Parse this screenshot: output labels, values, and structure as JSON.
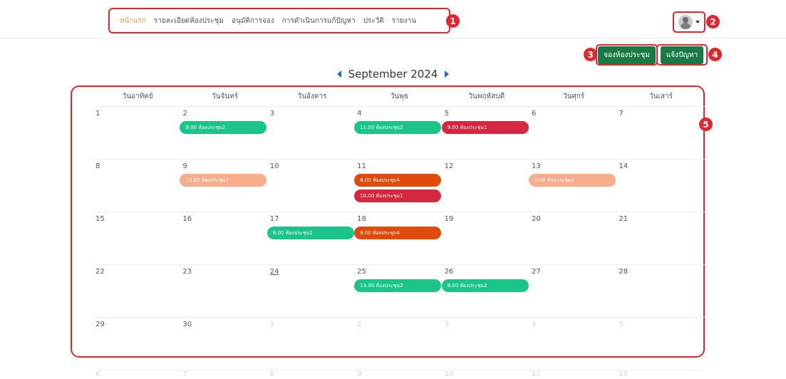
{
  "nav": {
    "items": [
      "หน้าแรก",
      "รายละเอียดห้องประชุม",
      "อนุมัติการจอง",
      "การดำเนินการแก้ปัญหา",
      "ประวัติ",
      "รายงาน"
    ]
  },
  "actions": {
    "book_label": "จองห้องประชุม",
    "report_label": "แจ้งปัญหา"
  },
  "calendar": {
    "month_label": "September 2024",
    "weekdays": [
      "วันอาทิตย์",
      "วันจันทร์",
      "วันอังคาร",
      "วันพุธ",
      "วันพฤหัสบดี",
      "วันศุกร์",
      "วันเสาร์"
    ],
    "weeks": [
      [
        "1",
        "2",
        "3",
        "4",
        "5",
        "6",
        "7"
      ],
      [
        "8",
        "9",
        "10",
        "11",
        "12",
        "13",
        "14"
      ],
      [
        "15",
        "16",
        "17",
        "18",
        "19",
        "20",
        "21"
      ],
      [
        "22",
        "23",
        "24",
        "25",
        "26",
        "27",
        "28"
      ],
      [
        "29",
        "30",
        "1",
        "2",
        "3",
        "4",
        "5"
      ]
    ],
    "next_month_days": [
      "6",
      "7",
      "8",
      "9",
      "10",
      "11",
      "12"
    ],
    "events": [
      {
        "week": 0,
        "day": 1,
        "slot": 0,
        "label": "9.00 ห้องประชุม2",
        "color": "#1cc48a"
      },
      {
        "week": 0,
        "day": 3,
        "slot": 0,
        "label": "11.00 ห้องประชุม2",
        "color": "#1cc48a"
      },
      {
        "week": 0,
        "day": 4,
        "slot": 0,
        "label": "9.00 ห้องประชุม1",
        "color": "#d3283f"
      },
      {
        "week": 1,
        "day": 1,
        "slot": 0,
        "label": "13.00 ห้องประชุม3",
        "color": "#f7ad8c"
      },
      {
        "week": 1,
        "day": 3,
        "slot": 0,
        "label": "8.00 ห้องประชุม4",
        "color": "#e04b0c"
      },
      {
        "week": 1,
        "day": 3,
        "slot": 1,
        "label": "10.00 ห้องประชุม1",
        "color": "#d3283f"
      },
      {
        "week": 1,
        "day": 5,
        "slot": 0,
        "label": "9.00 ห้องประชุม3",
        "color": "#f7ad8c"
      },
      {
        "week": 2,
        "day": 2,
        "slot": 0,
        "label": "8.00 ห้องประชุม2",
        "color": "#1cc48a"
      },
      {
        "week": 2,
        "day": 3,
        "slot": 0,
        "label": "9.00 ห้องประชุม4",
        "color": "#e04b0c"
      },
      {
        "week": 3,
        "day": 3,
        "slot": 0,
        "label": "13.00 ห้องประชุม2",
        "color": "#1cc48a"
      },
      {
        "week": 3,
        "day": 4,
        "slot": 0,
        "label": "9.00 ห้องประชุม2",
        "color": "#1cc48a"
      }
    ]
  },
  "markers": [
    "1",
    "2",
    "3",
    "4",
    "5"
  ]
}
